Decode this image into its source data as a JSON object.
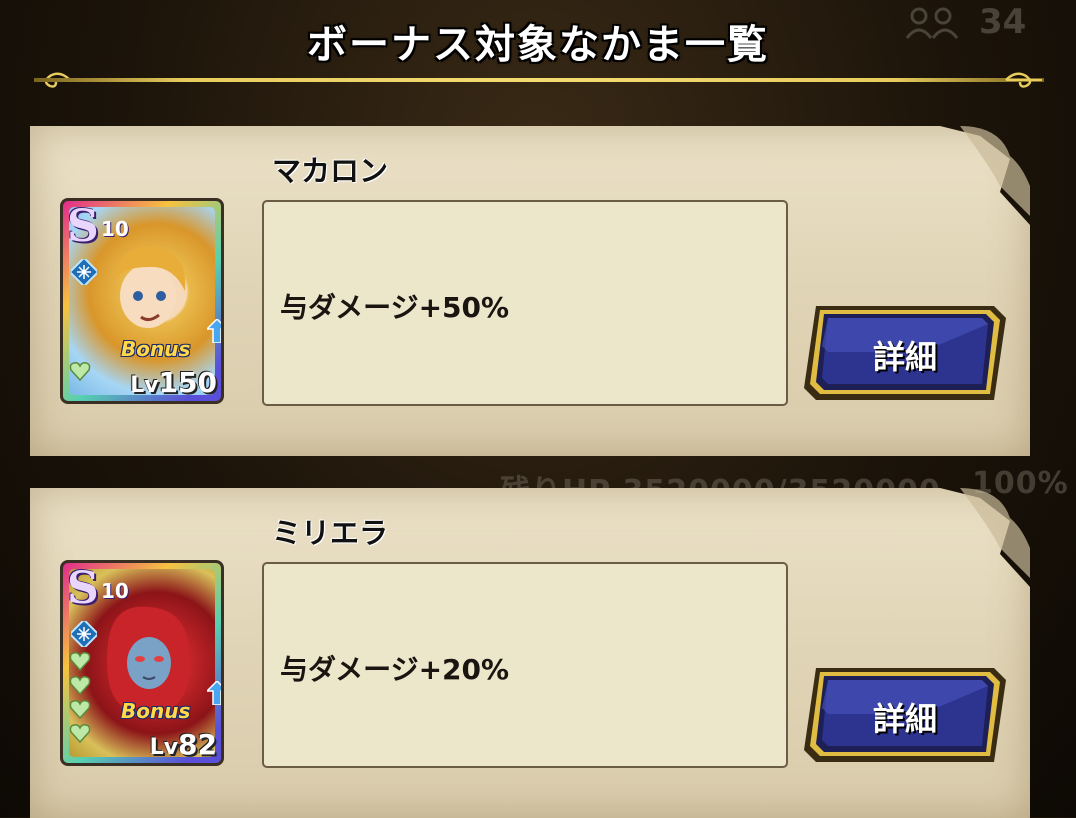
{
  "header": {
    "title": "ボーナス対象なかま一覧",
    "count": "34"
  },
  "background": {
    "hp_status": "残りHP 3520000/3520000",
    "hp_percent": "100%"
  },
  "members": [
    {
      "name": "マカロン",
      "rank": "S",
      "rank_level": "10",
      "bonus_label": "Bonus",
      "level_prefix": "Lv",
      "level": "150",
      "effect": "与ダメージ+50%",
      "detail_label": "詳細",
      "portrait_theme": "blonde-hero",
      "hearts": 1
    },
    {
      "name": "ミリエラ",
      "rank": "S",
      "rank_level": "10",
      "bonus_label": "Bonus",
      "level_prefix": "Lv",
      "level": "82",
      "effect": "与ダメージ+20%",
      "detail_label": "詳細",
      "portrait_theme": "red-haired-monster",
      "hearts": 4
    }
  ],
  "colors": {
    "gold_line": "#e8cc5e",
    "button_blue": "#2b2f7c",
    "button_border": "#d9b63a",
    "paper": "#e6dbbf",
    "bonus_text": "#ffd94a"
  }
}
